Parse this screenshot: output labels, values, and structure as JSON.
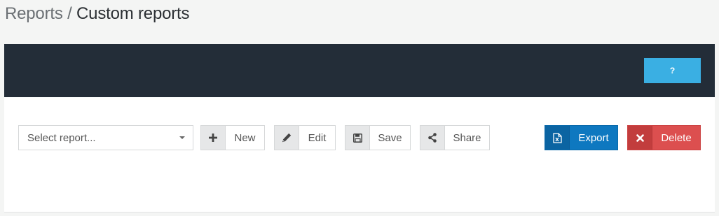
{
  "breadcrumb": {
    "parent": "Reports",
    "separator": " / ",
    "current": "Custom reports"
  },
  "header": {
    "help_label": "?"
  },
  "report_select": {
    "placeholder": "Select report..."
  },
  "toolbar": {
    "new_label": "New",
    "edit_label": "Edit",
    "save_label": "Save",
    "share_label": "Share",
    "export_label": "Export",
    "delete_label": "Delete"
  },
  "icons": {
    "new": "plus-icon",
    "edit": "pencil-icon",
    "save": "floppy-disk-icon",
    "share": "share-icon",
    "export": "excel-file-icon",
    "delete": "x-icon"
  },
  "colors": {
    "header_bg": "#232d38",
    "help_button": "#3aafe3",
    "export_button": "#0e78c0",
    "delete_button": "#dc4f4f"
  }
}
